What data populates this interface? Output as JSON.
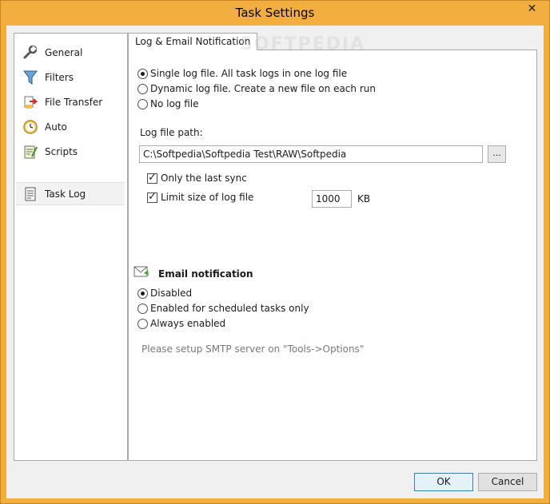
{
  "window": {
    "title": "Task Settings",
    "close_glyph": "✕"
  },
  "sidebar": {
    "items": [
      {
        "label": "General",
        "icon": "wrench-icon"
      },
      {
        "label": "Filters",
        "icon": "funnel-icon"
      },
      {
        "label": "File Transfer",
        "icon": "file-transfer-icon"
      },
      {
        "label": "Auto",
        "icon": "clock-icon"
      },
      {
        "label": "Scripts",
        "icon": "script-icon"
      },
      {
        "label": "Task Log",
        "icon": "document-icon",
        "selected": true
      }
    ]
  },
  "tab": {
    "label": "Log & Email Notification"
  },
  "watermark": "SOFTPEDIA",
  "log_mode": {
    "options": [
      {
        "label": "Single log file. All task logs in one log file",
        "selected": true
      },
      {
        "label": "Dynamic log file.  Create a new file on each run",
        "selected": false
      },
      {
        "label": "No log file",
        "selected": false
      }
    ]
  },
  "log_path": {
    "label": "Log file path:",
    "value": "C:\\Softpedia\\Softpedia Test\\RAW\\Softpedia",
    "browse_label": "..."
  },
  "options": {
    "only_last_sync": {
      "label": "Only the last sync",
      "checked": true
    },
    "limit_size": {
      "label": "Limit size of log file",
      "checked": true,
      "value": "1000",
      "unit": "KB"
    }
  },
  "email": {
    "heading": "Email notification",
    "options": [
      {
        "label": "Disabled",
        "selected": true
      },
      {
        "label": "Enabled for scheduled tasks only",
        "selected": false
      },
      {
        "label": "Always enabled",
        "selected": false
      }
    ],
    "hint": "Please setup SMTP server on \"Tools->Options\""
  },
  "buttons": {
    "ok": "OK",
    "cancel": "Cancel"
  }
}
